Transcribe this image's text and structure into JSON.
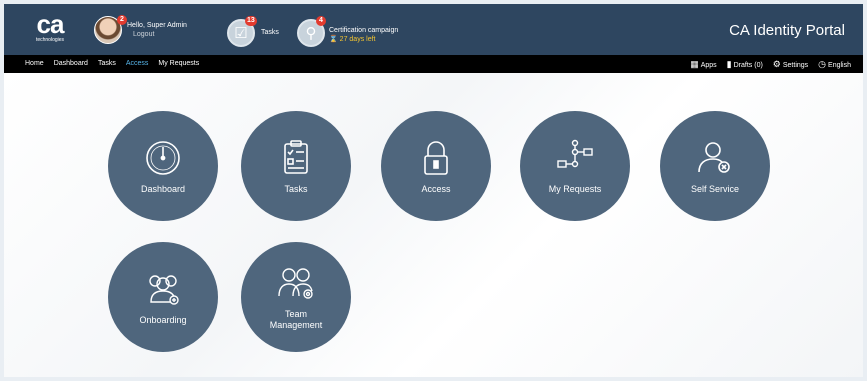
{
  "header": {
    "logo_mark": "ca",
    "logo_sub": "technologies",
    "greeting": "Hello, Super Admin",
    "logout": "Logout",
    "user_badge": "2",
    "tasks_badge": "13",
    "tasks_label": "Tasks",
    "cert_badge": "4",
    "cert_title": "Certification campaign",
    "cert_days": "27 days left",
    "portal_title": "CA Identity Portal"
  },
  "nav": {
    "items": [
      "Home",
      "Dashboard",
      "Tasks",
      "Access",
      "My Requests"
    ],
    "active": "Access",
    "right": [
      {
        "icon": "apps-icon",
        "label": "Apps"
      },
      {
        "icon": "drafts-icon",
        "label": "Drafts (0)"
      },
      {
        "icon": "settings-icon",
        "label": "Settings"
      },
      {
        "icon": "globe-icon",
        "label": "English"
      }
    ]
  },
  "tiles": [
    {
      "id": "dashboard",
      "label": "Dashboard",
      "icon": "gauge-icon"
    },
    {
      "id": "tasks",
      "label": "Tasks",
      "icon": "clipboard-icon"
    },
    {
      "id": "access",
      "label": "Access",
      "icon": "lock-icon"
    },
    {
      "id": "my-requests",
      "label": "My Requests",
      "icon": "workflow-icon"
    },
    {
      "id": "self-service",
      "label": "Self Service",
      "icon": "user-settings-icon"
    },
    {
      "id": "onboarding",
      "label": "Onboarding",
      "icon": "add-users-icon"
    },
    {
      "id": "team-management",
      "label": "Team\nManagement",
      "icon": "team-settings-icon"
    }
  ],
  "colors": {
    "header_bg": "#2e4660",
    "tile_bg": "#4f667d",
    "nav_active": "#57b4e8",
    "badge": "#e23b2f"
  }
}
